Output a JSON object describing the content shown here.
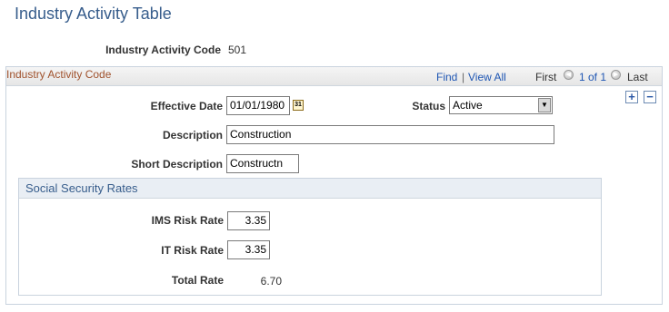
{
  "page": {
    "title": "Industry Activity Table"
  },
  "key": {
    "label": "Industry Activity Code",
    "value": "501"
  },
  "group": {
    "title": "Industry Activity Code",
    "nav": {
      "find": "Find",
      "separator": "|",
      "view_all": "View All",
      "first": "First",
      "range": "1 of 1",
      "last": "Last"
    },
    "add_icon": "plus-icon",
    "delete_icon": "minus-icon"
  },
  "form": {
    "effective_date": {
      "label": "Effective Date",
      "value": "01/01/1980",
      "icon": "calendar-icon"
    },
    "status": {
      "label": "Status",
      "value": "Active"
    },
    "description": {
      "label": "Description",
      "value": "Construction"
    },
    "short_description": {
      "label": "Short Description",
      "value": "Constructn"
    }
  },
  "social_security": {
    "title": "Social Security Rates",
    "ims_risk_rate": {
      "label": "IMS Risk Rate",
      "value": "3.35"
    },
    "it_risk_rate": {
      "label": "IT Risk Rate",
      "value": "3.35"
    },
    "total_rate": {
      "label": "Total Rate",
      "value": "6.70"
    }
  },
  "colors": {
    "title_blue": "#375d8c",
    "link_blue": "#1f56b3",
    "group_title_brown": "#a0522d"
  }
}
